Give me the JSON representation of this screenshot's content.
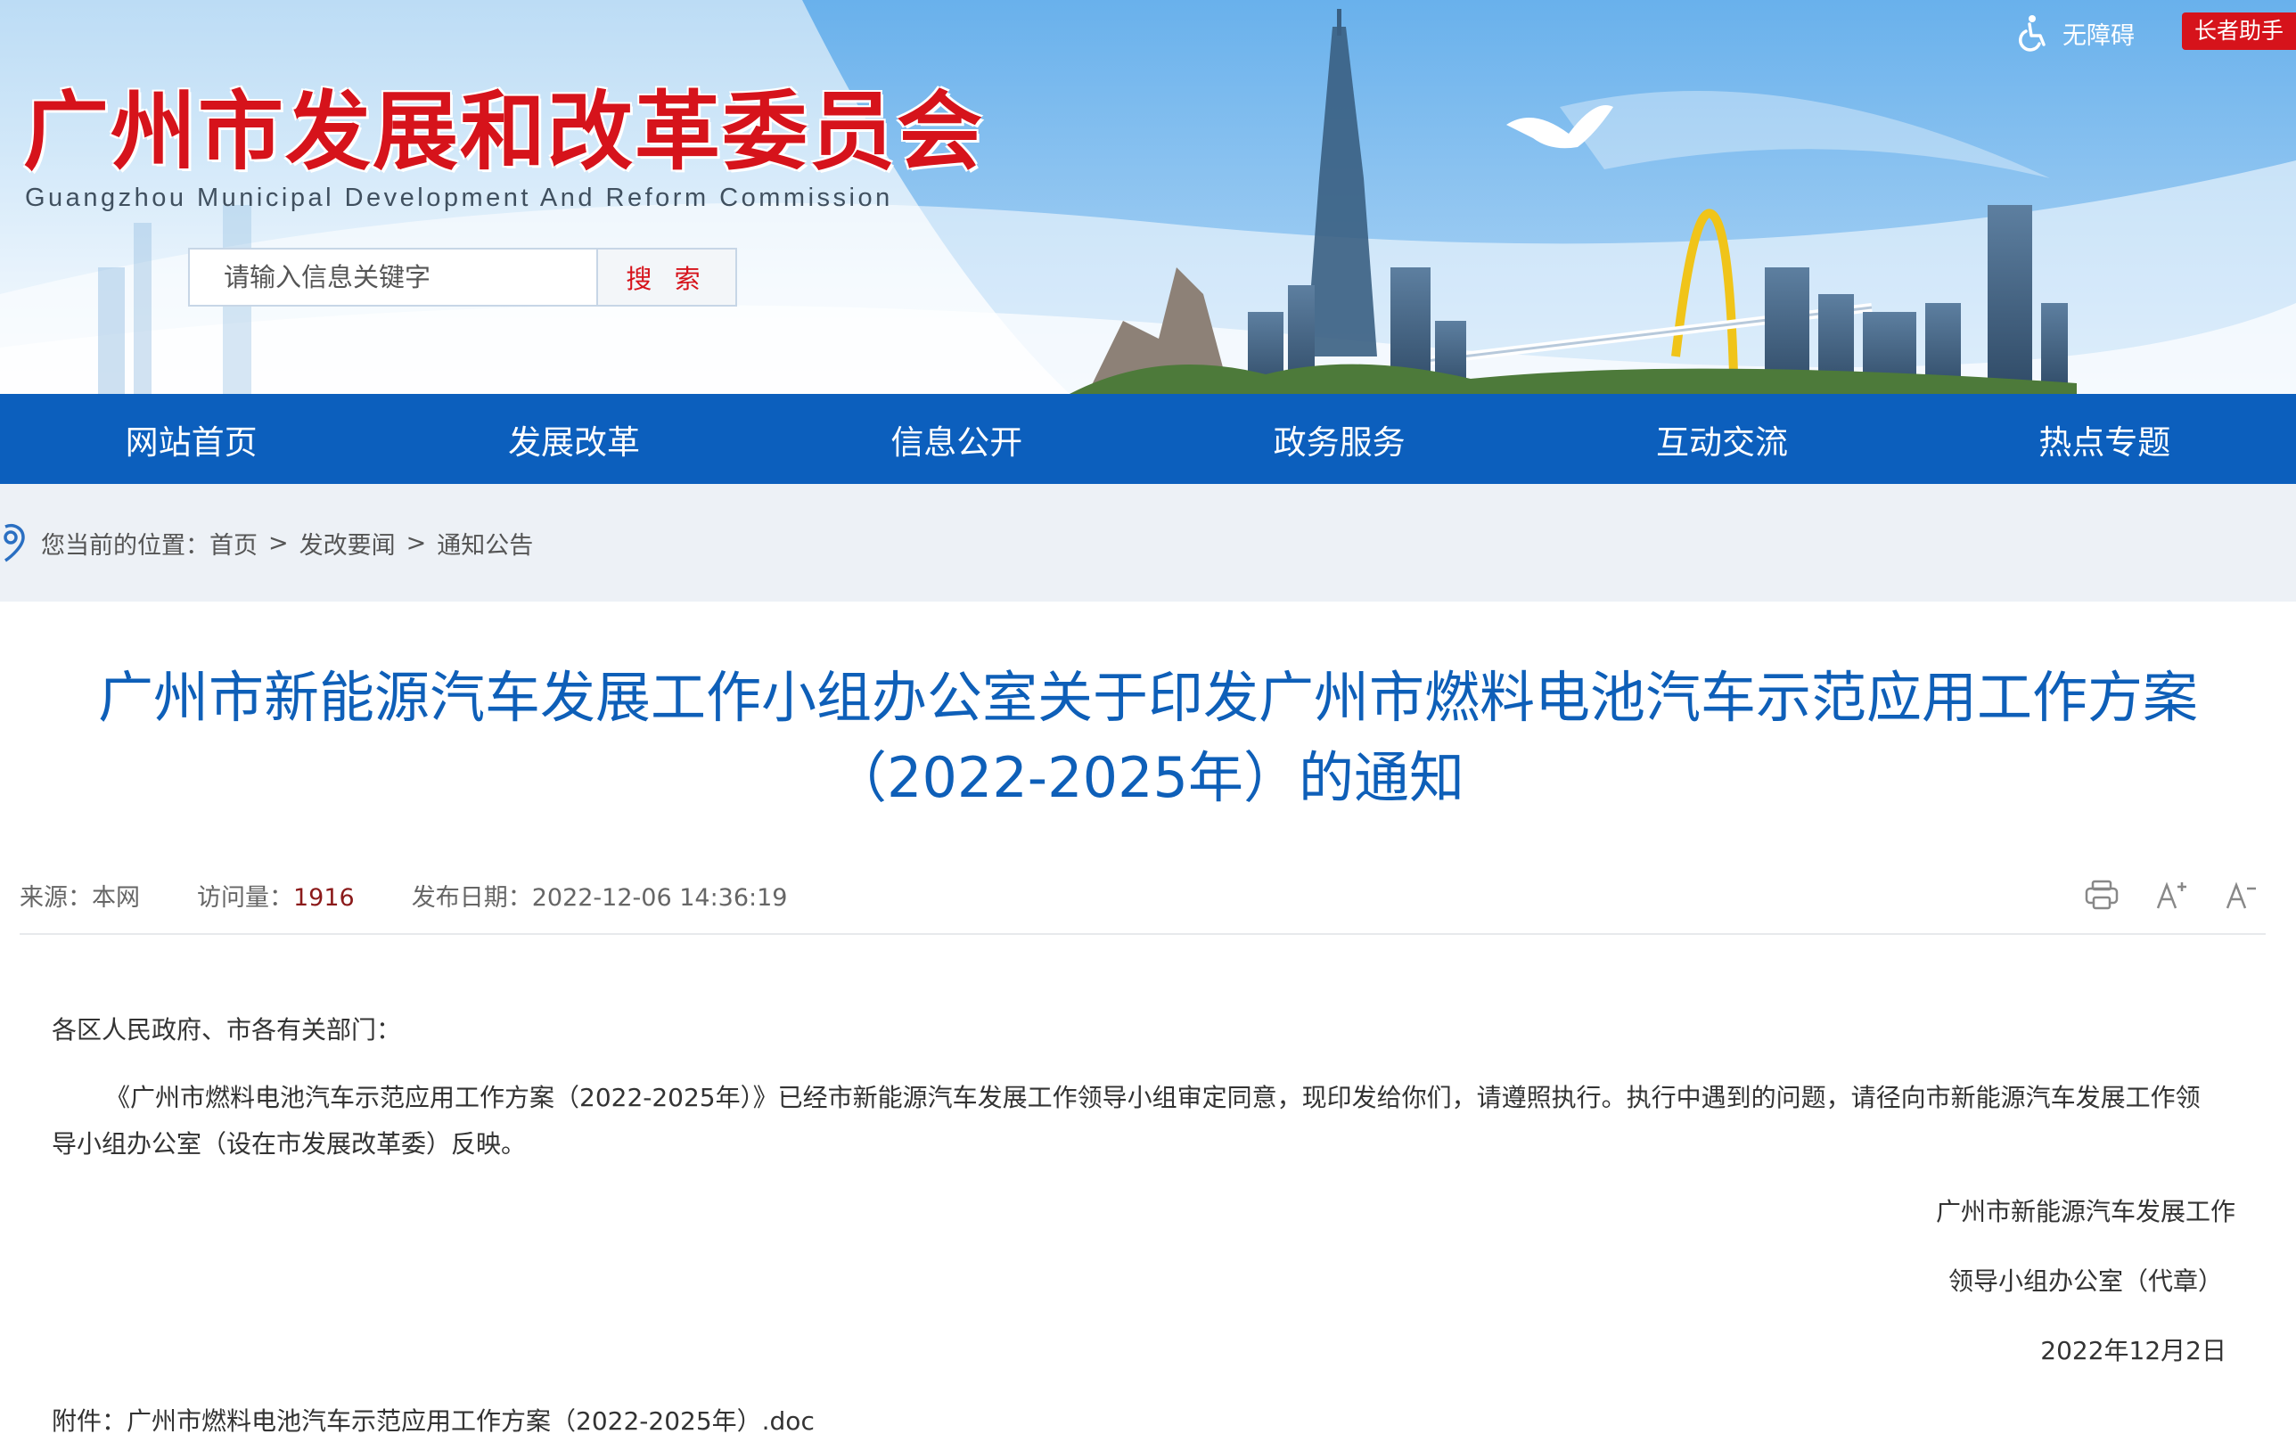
{
  "header": {
    "title": "广州市发展和改革委员会",
    "subtitle": "Guangzhou Municipal Development And Reform Commission",
    "search_placeholder": "请输入信息关键字",
    "search_button": "搜 索",
    "accessibility_label": "无障碍",
    "elder_mode_label": "长者助手"
  },
  "nav": {
    "items": [
      "网站首页",
      "发展改革",
      "信息公开",
      "政务服务",
      "互动交流",
      "热点专题"
    ]
  },
  "breadcrumb": {
    "prefix": "您当前的位置：",
    "home": "首页",
    "section": "发改要闻",
    "current": "通知公告",
    "separator": ">"
  },
  "article": {
    "title_line1": "广州市新能源汽车发展工作小组办公室关于印发广州市燃料电池汽车示范应用工作方案",
    "title_line2": "（2022-2025年）的通知",
    "source_label": "来源：",
    "source_value": "本网",
    "hits_label": "访问量：",
    "hits_value": "1916",
    "date_label": "发布日期：",
    "date_value": "2022-12-06 14:36:19",
    "greeting": "各区人民政府、市各有关部门：",
    "body": "《广州市燃料电池汽车示范应用工作方案（2022-2025年）》已经市新能源汽车发展工作领导小组审定同意，现印发给你们，请遵照执行。执行中遇到的问题，请径向市新能源汽车发展工作领导小组办公室（设在市发展改革委）反映。",
    "signature_line1": "广州市新能源汽车发展工作",
    "signature_line2": "领导小组办公室（代章）",
    "signature_date": "2022年12月2日",
    "attachment_label": "附件：",
    "attachment_name": "广州市燃料电池汽车示范应用工作方案（2022-2025年）.doc"
  },
  "tools": {
    "print_icon": "printer-icon",
    "font_increase_icon": "font-increase-icon",
    "font_decrease_icon": "font-decrease-icon"
  },
  "colors": {
    "brand_red": "#d6131b",
    "nav_blue": "#0c5fbd",
    "title_blue": "#0e5fb8",
    "breadcrumb_bg": "#edf1f6"
  }
}
